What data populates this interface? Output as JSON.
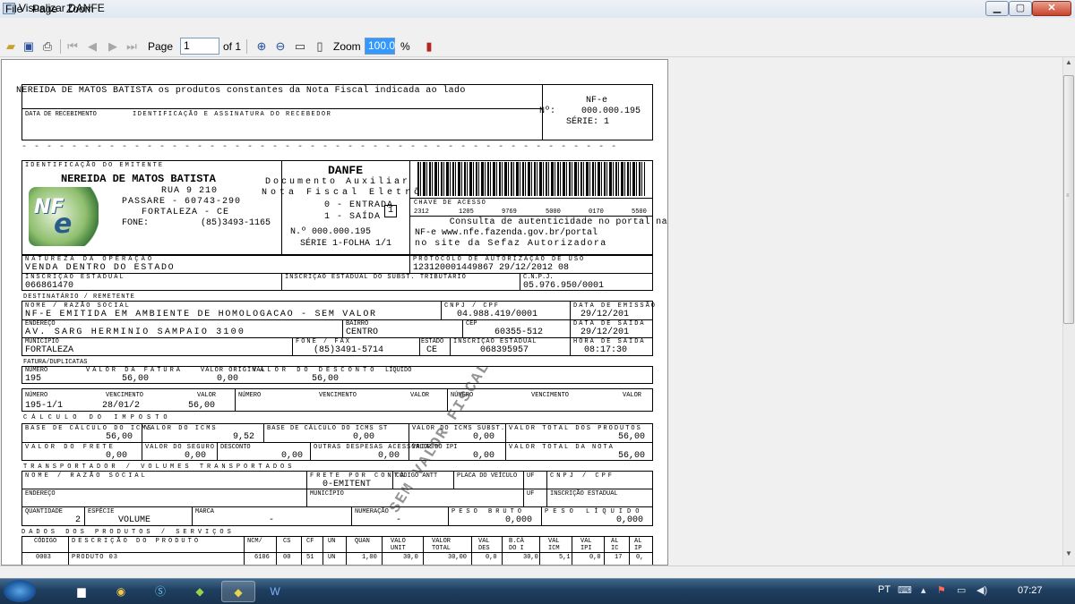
{
  "window": {
    "title": "Visualizar DANFE"
  },
  "menu": [
    "File",
    "Page",
    "Zoom"
  ],
  "toolbar": {
    "page_label": "Page",
    "page_value": "1",
    "of_label": "of 1",
    "zoom_label": "Zoom",
    "zoom_value": "100.0",
    "percent": "%"
  },
  "danfe": {
    "receipt_header": "NEREIDA DE MATOS BATISTA os produtos constantes da Nota Fiscal indicada ao lado",
    "receipt_date": "DATA DE RECEBIMENTO",
    "receipt_ident": "IDENTIFICAÇÃO E ASSINATURA DO RECEBEDOR",
    "nfe": "NF-e",
    "number_label": "Nº:",
    "number_value": "000.000.195",
    "serie": "SÉRIE: 1",
    "emitente_label": "IDENTIFICAÇÃO DO EMITENTE",
    "emitente_name": "NEREIDA DE MATOS BATISTA",
    "address_1": "RUA 9 210",
    "address_2": "PASSARE - 60743-290",
    "address_3": "FORTALEZA - CE",
    "phone_label": "FONE:",
    "phone_value": "(85)3493-1165",
    "danfe_title": "DANFE",
    "danfe_sub_1": "Documento Auxiliar",
    "danfe_sub_2": "Nota Fiscal Eletrônica",
    "entrada": "0 - ENTRADA",
    "saida": "1 - SAÍDA",
    "tipo_value": "1",
    "number_line": "N.º 000.000.195",
    "serie_folha": "SÉRIE 1-FOLHA 1/1",
    "chave_label": "CHAVE DE ACESSO",
    "chave_parts": [
      "2312",
      "1205",
      "9769",
      "5000",
      "0170",
      "5500"
    ],
    "consulta_1": "Consulta de autenticidade no portal na",
    "consulta_2": "NF-e www.nfe.fazenda.gov.br/portal",
    "consulta_3": "no site da Sefaz Autorizadora",
    "natureza_label": "NATUREZA DA OPERAÇÃO",
    "natureza_value": "VENDA DENTRO DO ESTADO",
    "protocolo_label": "PROTOCOLO DE AUTORIZAÇÃO DE USO",
    "protocolo_value": "123120001449867 29/12/2012 08",
    "ie_label": "INSCRIÇÃO ESTADUAL",
    "ie_value": "066861470",
    "ie_subst_label": "INSCRIÇÃO ESTADUAL DO SUBST. TRIBUTÁRIO",
    "cnpj_label": "C.N.P.J.",
    "cnpj_value": "05.976.950/0001",
    "dest_section": "DESTINATÁRIO / REMETENTE",
    "dest_nome_label": "NOME / RAZÃO SOCIAL",
    "dest_nome_value": "NF-E EMITIDA EM AMBIENTE DE HOMOLOGACAO - SEM VALOR",
    "dest_cnpj_label": "CNPJ / CPF",
    "dest_cnpj_value": "04.988.419/0001",
    "dest_data_label": "DATA DE EMISSÃO",
    "dest_data_value": "29/12/201",
    "endereco_label": "ENDEREÇO",
    "endereco_value": "AV. SARG HERMINIO SAMPAIO 3100",
    "bairro_label": "BAIRRO",
    "bairro_value": "CENTRO",
    "cep_label": "CEP",
    "cep_value": "60355-512",
    "data_saida_label": "DATA DE SAÍDA",
    "data_saida_value": "29/12/201",
    "municipio_label": "MUNICÍPIO",
    "municipio_value": "FORTALEZA",
    "fone_label": "FONE / FAX",
    "fone_value": "(85)3491-5714",
    "uf_label": "ESTADO",
    "uf_value": "CE",
    "dest_ie_label": "INSCRIÇÃO ESTADUAL",
    "dest_ie_value": "068395957",
    "hora_label": "HORA DE SAÍDA",
    "hora_value": "08:17:30",
    "fatura_section": "FATURA/DUPLICATAS",
    "fatura_numero_label": "NÚMERO",
    "fatura_numero_value": "195",
    "fatura_valor_label": "VALOR DA FATURA",
    "fatura_valor_value": "56,00",
    "fatura_orig_label": "VALOR ORIGINAL",
    "fatura_orig_value": "0,00",
    "fatura_desc_label": "VALOR DO DESCONTO",
    "fatura_desc_value": "56,00",
    "fatura_liq_label": "LÍQUIDO",
    "dup_numero_label": "NÚMERO",
    "dup_venc_label": "VENCIMENTO",
    "dup_valor_label": "VALOR",
    "dup_numero_value": "195-1/1",
    "dup_venc_value": "28/01/2",
    "dup_valor_value": "56,00",
    "imposto_section": "CÁLCULO DO IMPOSTO",
    "base_icms_label": "BASE DE CÁLCULO DO ICMS",
    "base_icms_value": "56,00",
    "valor_icms_label": "VALOR DO ICMS",
    "valor_icms_value": "9,52",
    "base_st_label": "BASE DE CÁLCULO DO ICMS ST",
    "base_st_value": "0,00",
    "valor_st_label": "VALOR DO ICMS SUBST.",
    "valor_st_value": "0,00",
    "total_prod_label": "VALOR TOTAL DOS PRODUTOS",
    "total_prod_value": "56,00",
    "frete_label": "VALOR DO FRETE",
    "frete_value": "0,00",
    "seguro_label": "VALOR DO SEGURO",
    "seguro_value": "0,00",
    "desconto_label": "DESCONTO",
    "desconto_value": "0,00",
    "outras_label": "OUTRAS DESPESAS ACESSÓRIAS",
    "outras_value": "0,00",
    "ipi_label": "VALOR DO IPI",
    "ipi_value": "0,00",
    "total_nota_label": "VALOR TOTAL DA NOTA",
    "total_nota_value": "56,00",
    "transp_section": "TRANSPORTADOR / VOLUMES TRANSPORTADOS",
    "transp_nome_label": "NOME / RAZÃO SOCIAL",
    "transp_frete_label": "FRETE POR CONTA",
    "transp_frete_value": "0-EMITENT",
    "antt_label": "CÓDIGO ANTT",
    "placa_label": "PLACA DO VEÍCULO",
    "transp_uf_label": "UF",
    "transp_cnpj_label": "CNPJ / CPF",
    "transp_end_label": "ENDEREÇO",
    "transp_mun_label": "MUNICÍPIO",
    "transp_ie_label": "INSCRIÇÃO ESTADUAL",
    "qtd_label": "QUANTIDADE",
    "qtd_value": "2",
    "especie_label": "ESPÉCIE",
    "especie_value": "VOLUME",
    "marca_label": "MARCA",
    "marca_value": "-",
    "numeracao_label": "NUMERAÇÃO",
    "numeracao_value": "-",
    "peso_bruto_label": "PESO BRUTO",
    "peso_bruto_value": "0,000",
    "peso_liq_label": "PESO LÍQUIDO",
    "peso_liq_value": "0,000",
    "produtos_section": "DADOS DOS PRODUTOS / SERVIÇOS",
    "produtos_headers": [
      "CÓDIGO",
      "DESCRIÇÃO DO PRODUTO",
      "NCM/",
      "CS",
      "CF",
      "UN",
      "QUAN",
      "VALO UNIT",
      "VALOR TOTAL",
      "VAL DES",
      "B.CÁ DO I",
      "VAL ICM",
      "VAL IPI",
      "AL IC",
      "AL IP"
    ],
    "produtos_row": [
      "0003",
      "PRODUTO 03",
      "6106",
      "00",
      "51",
      "UN",
      "1,00",
      "30,0",
      "30,00",
      "0,0",
      "30,0",
      "5,1",
      "0,0",
      "17",
      "0,"
    ],
    "watermark": "SEM VALOR FISCAL"
  },
  "taskbar": {
    "lang": "PT",
    "clock": "07:27",
    "apps": [
      "explorer-icon",
      "chrome-icon",
      "skype-icon",
      "app-icon",
      "danfe-icon",
      "word-icon"
    ]
  }
}
